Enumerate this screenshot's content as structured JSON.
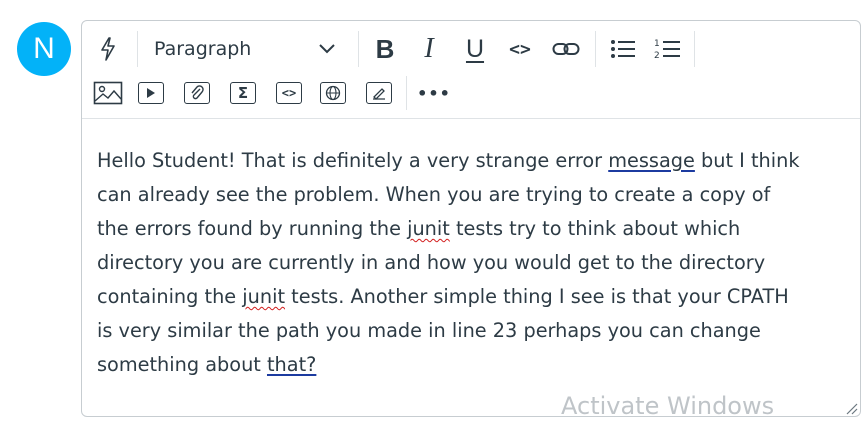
{
  "avatar": {
    "initial": "N",
    "color": "#03b2f8"
  },
  "toolbar": {
    "row1": [
      {
        "icon": "lightning-icon"
      },
      {
        "type": "select",
        "value": "Paragraph"
      },
      {
        "icon": "bold-icon",
        "label": "B"
      },
      {
        "icon": "italic-icon",
        "label": "I"
      },
      {
        "icon": "underline-icon",
        "label": "U"
      },
      {
        "icon": "code-icon",
        "label": "<>"
      },
      {
        "icon": "link-icon"
      },
      {
        "icon": "bulleted-list-icon"
      },
      {
        "icon": "numbered-list-icon"
      }
    ],
    "row2": [
      {
        "icon": "image-icon"
      },
      {
        "icon": "media-icon"
      },
      {
        "icon": "attachment-icon"
      },
      {
        "icon": "equation-icon",
        "label": "Σ"
      },
      {
        "icon": "embed-icon",
        "label": "<>"
      },
      {
        "icon": "globe-icon"
      },
      {
        "icon": "document-icon"
      },
      {
        "icon": "more-icon",
        "label": "•••"
      }
    ]
  },
  "content": {
    "lines": [
      [
        {
          "text": "Hello Student! That is definitely a very strange error "
        },
        {
          "text": "message",
          "style": "link"
        },
        {
          "text": " but I think"
        }
      ],
      [
        {
          "text": "can already see the problem. When you are trying to create a copy of"
        }
      ],
      [
        {
          "text": "the errors found by running the "
        },
        {
          "text": "junit",
          "style": "spell"
        },
        {
          "text": " tests try to think about which"
        }
      ],
      [
        {
          "text": "directory you are currently in and how you would get to the directory"
        }
      ],
      [
        {
          "text": "containing the "
        },
        {
          "text": "junit",
          "style": "spell"
        },
        {
          "text": " tests. Another simple thing I see is that your CPATH"
        }
      ],
      [
        {
          "text": "is very similar the path you made in line 23 perhaps you can change"
        }
      ],
      [
        {
          "text": "something about "
        },
        {
          "text": "that?",
          "style": "link"
        }
      ]
    ]
  },
  "watermark": "Activate Windows"
}
